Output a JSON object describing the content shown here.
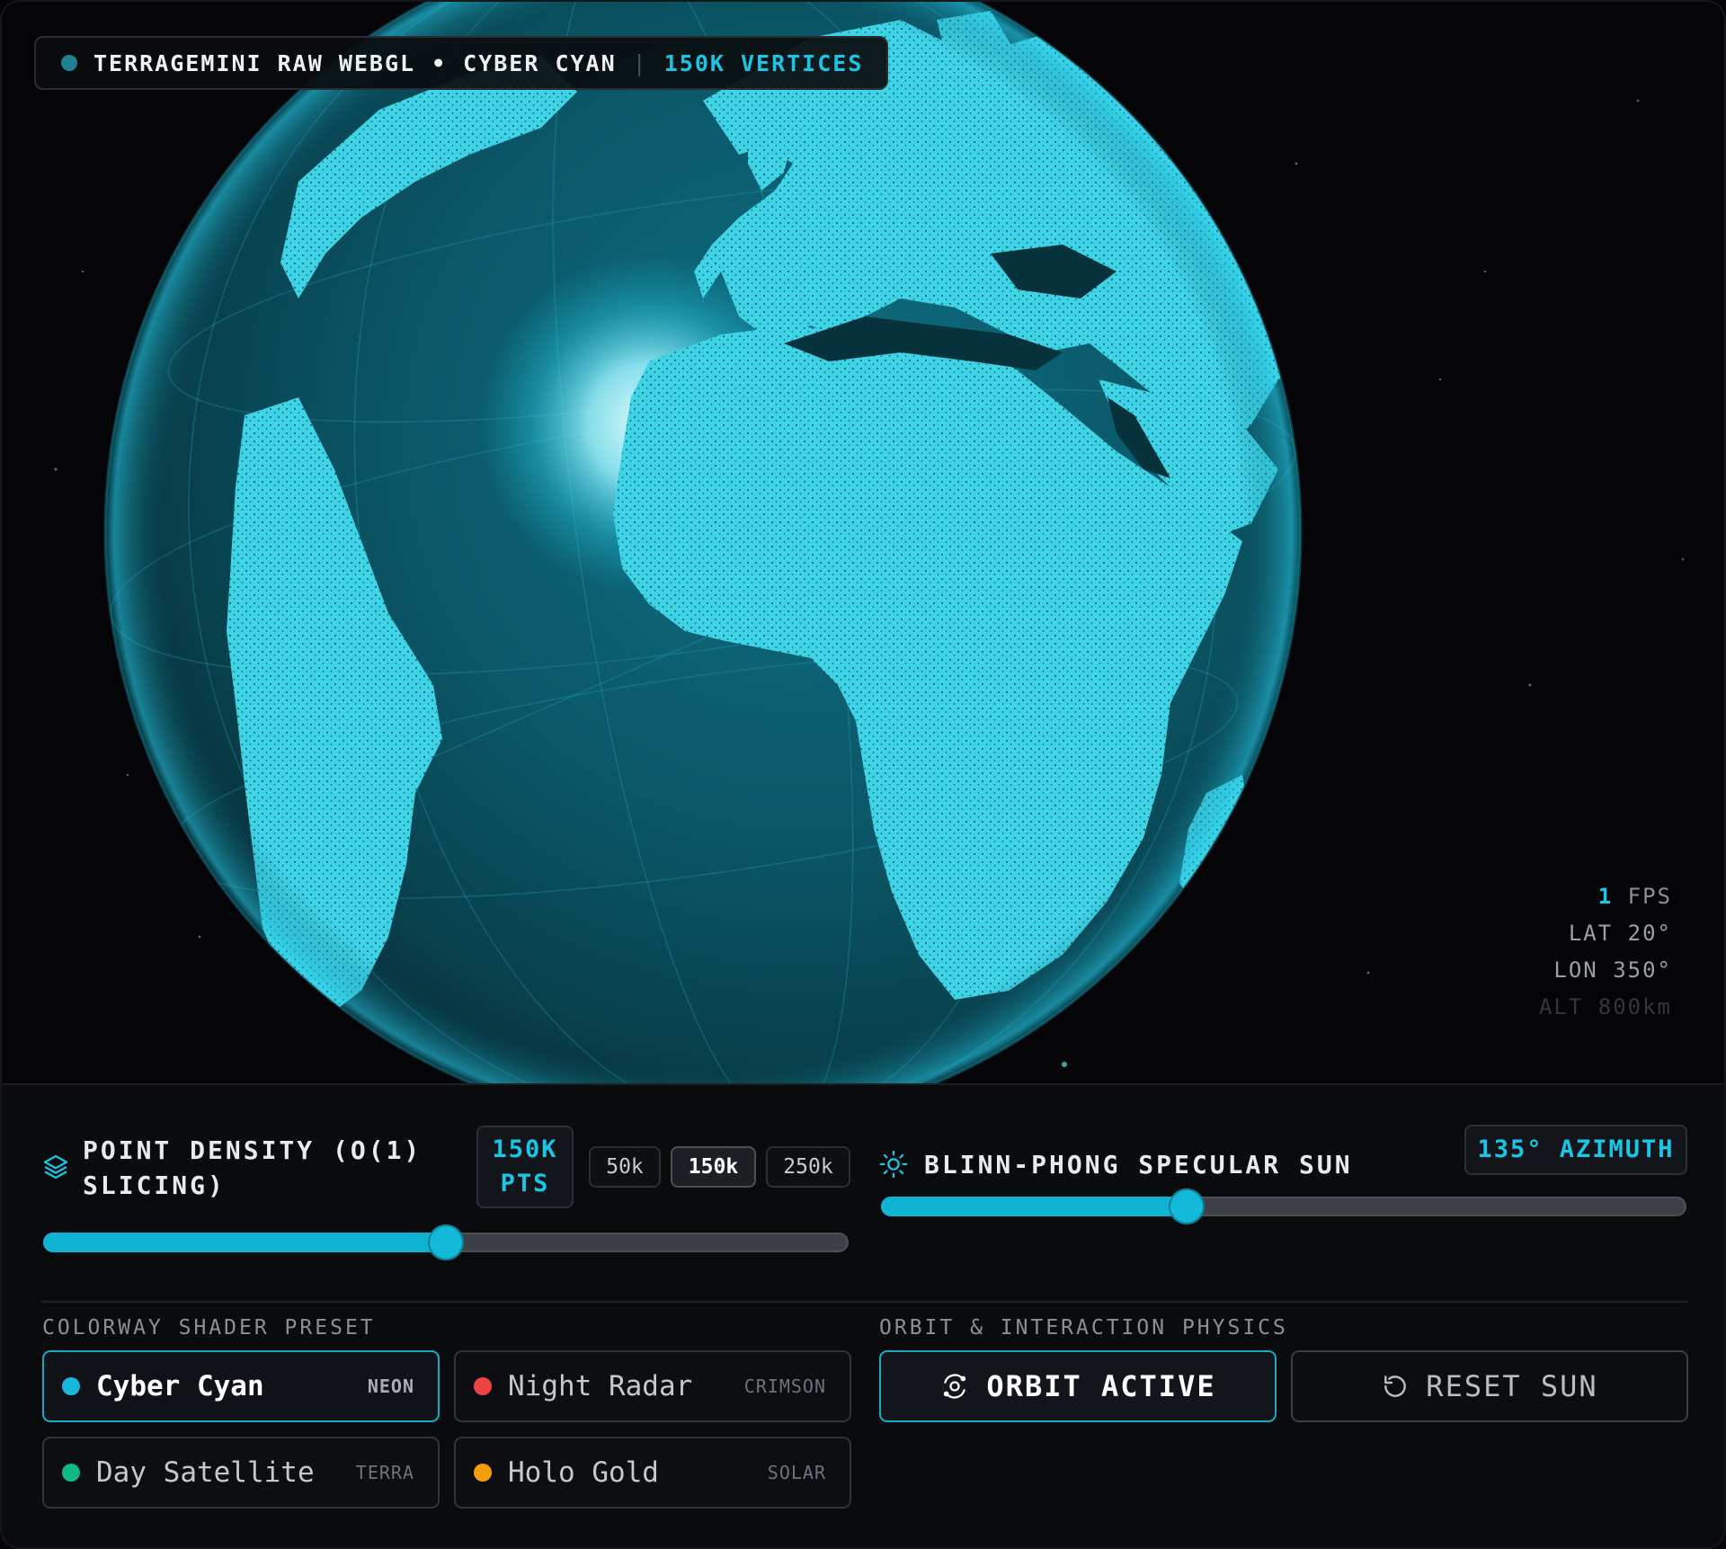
{
  "header": {
    "title": "TERRAGEMINI RAW WEBGL",
    "bullet": "•",
    "theme": "CYBER CYAN",
    "separator": "|",
    "vertex_count": "150K VERTICES"
  },
  "telemetry": {
    "fps_value": "1",
    "fps_label": "FPS",
    "lat": "LAT 20°",
    "lon": "LON 350°",
    "alt": "ALT 800km"
  },
  "density": {
    "heading_line1": "POINT DENSITY (O(1)",
    "heading_line2": "SLICING)",
    "badge_line1": "150K",
    "badge_line2": "PTS",
    "chips": [
      "50k",
      "150k",
      "250k"
    ],
    "selected_chip": "150k",
    "slider_value": 0.5
  },
  "sun": {
    "heading": "BLINN-PHONG SPECULAR SUN",
    "badge": "135° AZIMUTH",
    "slider_value": 0.38
  },
  "colorway": {
    "label": "COLORWAY SHADER PRESET",
    "presets": [
      {
        "name": "Cyber Cyan",
        "tag": "NEON",
        "color": "#19b7dc",
        "active": true
      },
      {
        "name": "Night Radar",
        "tag": "CRIMSON",
        "color": "#ef4444",
        "active": false
      },
      {
        "name": "Day Satellite",
        "tag": "TERRA",
        "color": "#10b981",
        "active": false
      },
      {
        "name": "Holo Gold",
        "tag": "SOLAR",
        "color": "#f59e0b",
        "active": false
      }
    ]
  },
  "physics": {
    "label": "ORBIT & INTERACTION PHYSICS",
    "orbit_button": "ORBIT ACTIVE",
    "reset_button": "RESET SUN"
  },
  "colors": {
    "accent": "#19c6e6",
    "background": "#050507",
    "panel": "#0a0b0d",
    "land": "#3fd3e6",
    "ocean": "#0b5262"
  }
}
